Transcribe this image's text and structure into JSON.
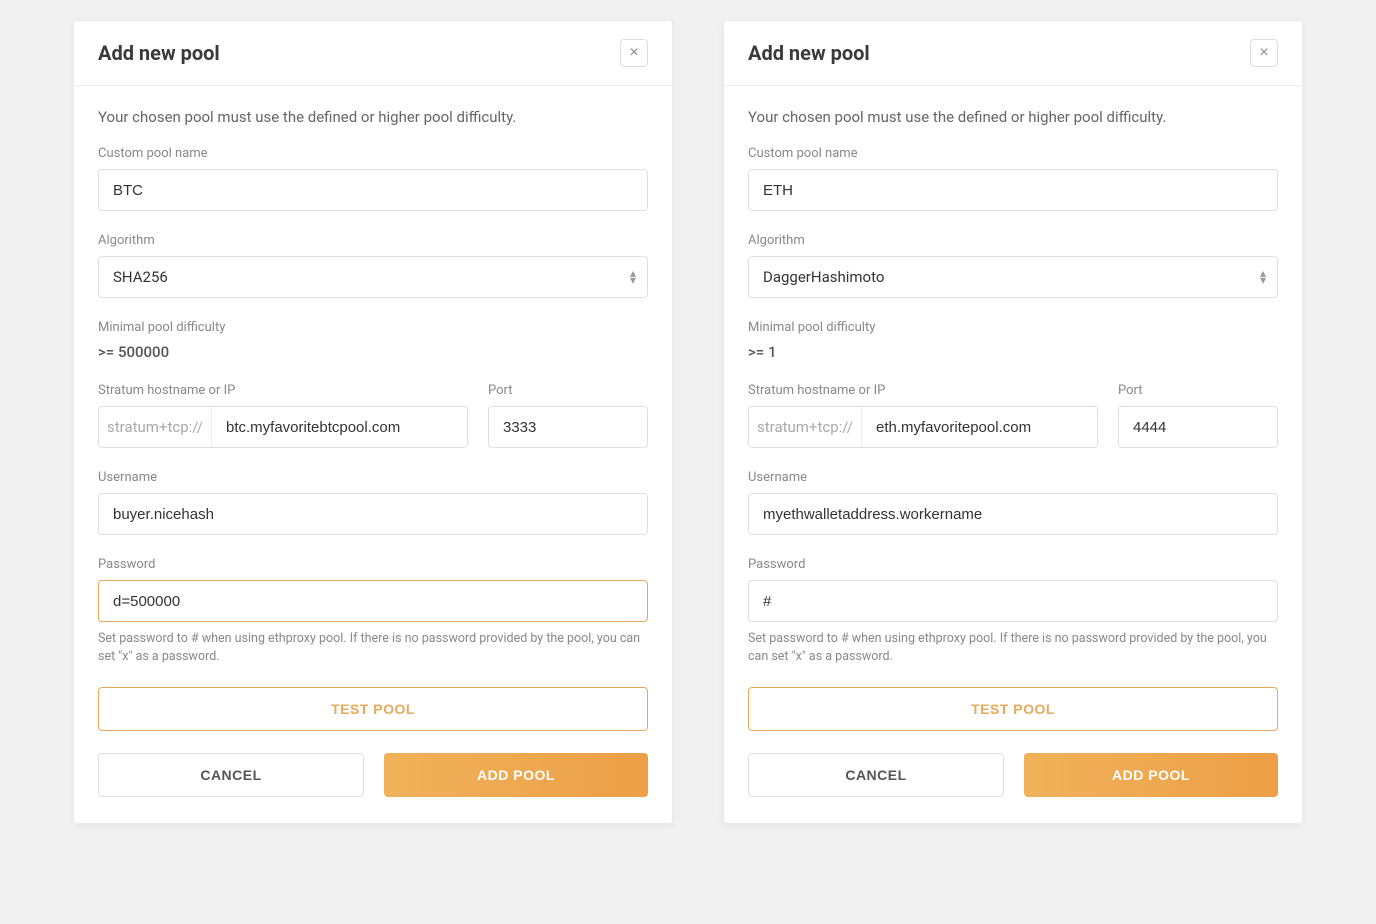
{
  "left": {
    "title": "Add new pool",
    "description": "Your chosen pool must use the defined or higher pool difficulty.",
    "labels": {
      "name": "Custom pool name",
      "algorithm": "Algorithm",
      "difficulty": "Minimal pool difficulty",
      "hostname": "Stratum hostname or IP",
      "port": "Port",
      "username": "Username",
      "password": "Password"
    },
    "values": {
      "name": "BTC",
      "algorithm": "SHA256",
      "difficulty": ">= 500000",
      "stratum_prefix": "stratum+tcp://",
      "hostname": "btc.myfavoritebtcpool.com",
      "port": "3333",
      "username": "buyer.nicehash",
      "password": "d=500000"
    },
    "hint": "Set password to # when using ethproxy pool. If there is no password provided by the pool, you can set \"x\" as a password.",
    "buttons": {
      "test": "Test Pool",
      "cancel": "Cancel",
      "add": "Add Pool"
    }
  },
  "right": {
    "title": "Add new pool",
    "description": "Your chosen pool must use the defined or higher pool difficulty.",
    "labels": {
      "name": "Custom pool name",
      "algorithm": "Algorithm",
      "difficulty": "Minimal pool difficulty",
      "hostname": "Stratum hostname or IP",
      "port": "Port",
      "username": "Username",
      "password": "Password"
    },
    "values": {
      "name": "ETH",
      "algorithm": "DaggerHashimoto",
      "difficulty": ">= 1",
      "stratum_prefix": "stratum+tcp://",
      "hostname": "eth.myfavoritepool.com",
      "port": "4444",
      "username": "myethwalletaddress.workername",
      "password": "#"
    },
    "hint": "Set password to # when using ethproxy pool. If there is no password provided by the pool, you can set \"x\" as a password.",
    "buttons": {
      "test": "Test Pool",
      "cancel": "Cancel",
      "add": "Add Pool"
    }
  }
}
